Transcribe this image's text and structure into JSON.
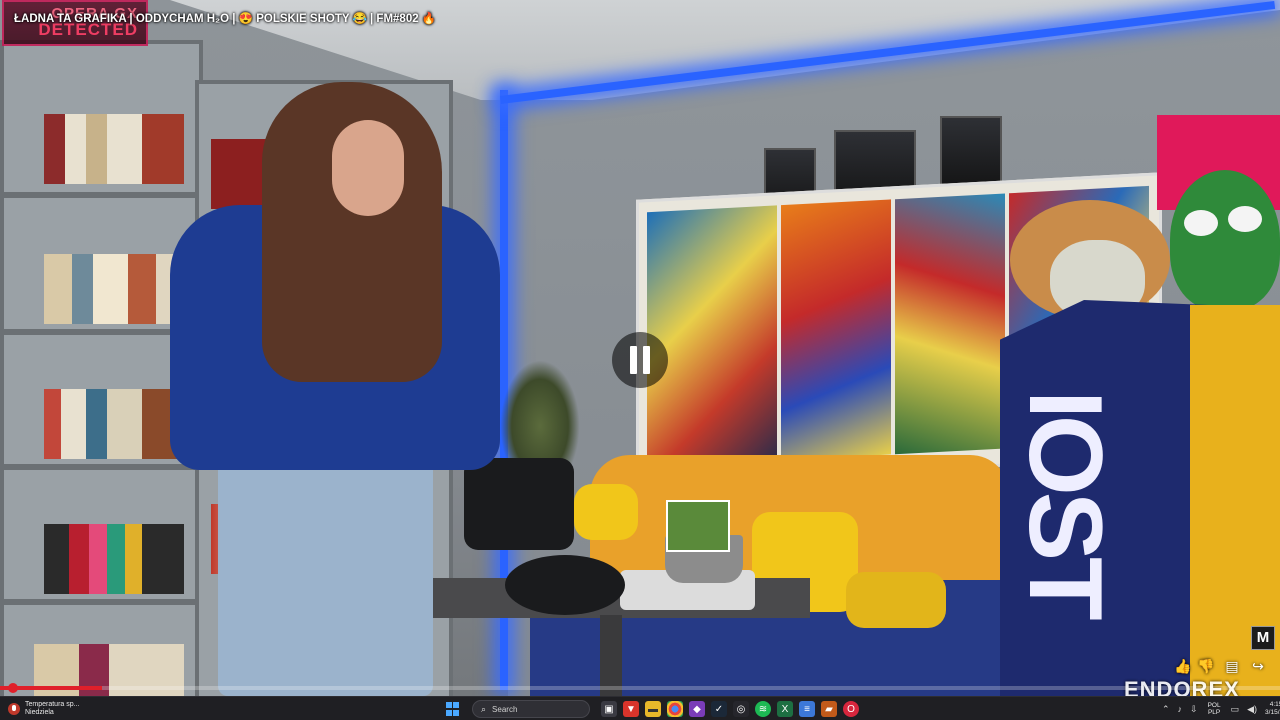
{
  "stream": {
    "title": "ŁADNA TA GRAFIKA | ODDYCHAM H₂O | 😍 POLSKIE SHOTY 😂 | FM#802 🔥",
    "badge_line1": "OPERA GX",
    "badge_line2": "DETECTED",
    "m_badge": "M",
    "brand_watermark": "ENDOREX",
    "progress": 0.08
  },
  "scene": {
    "scarf_text": "IOST"
  },
  "video_controls": {
    "like_icon": "thumbs-up-icon",
    "dislike_icon": "thumbs-down-icon",
    "chat_icon": "chat-icon",
    "share_icon": "share-icon",
    "like_glyph": "👍",
    "dislike_glyph": "👎",
    "chat_glyph": "▤",
    "share_glyph": "↪"
  },
  "taskbar": {
    "weather_line1": "Temperatura sp...",
    "weather_line2": "Niedziela",
    "search_placeholder": "Search",
    "lang_line1": "POL",
    "lang_line2": "PLP",
    "time": "4:15 PM",
    "date": "3/15/2026"
  },
  "colors": {
    "accent_red": "#e0202a",
    "led_blue": "#2a63ff",
    "taskbar_bg": "#1f1f23",
    "opera_pink": "#c71753"
  }
}
